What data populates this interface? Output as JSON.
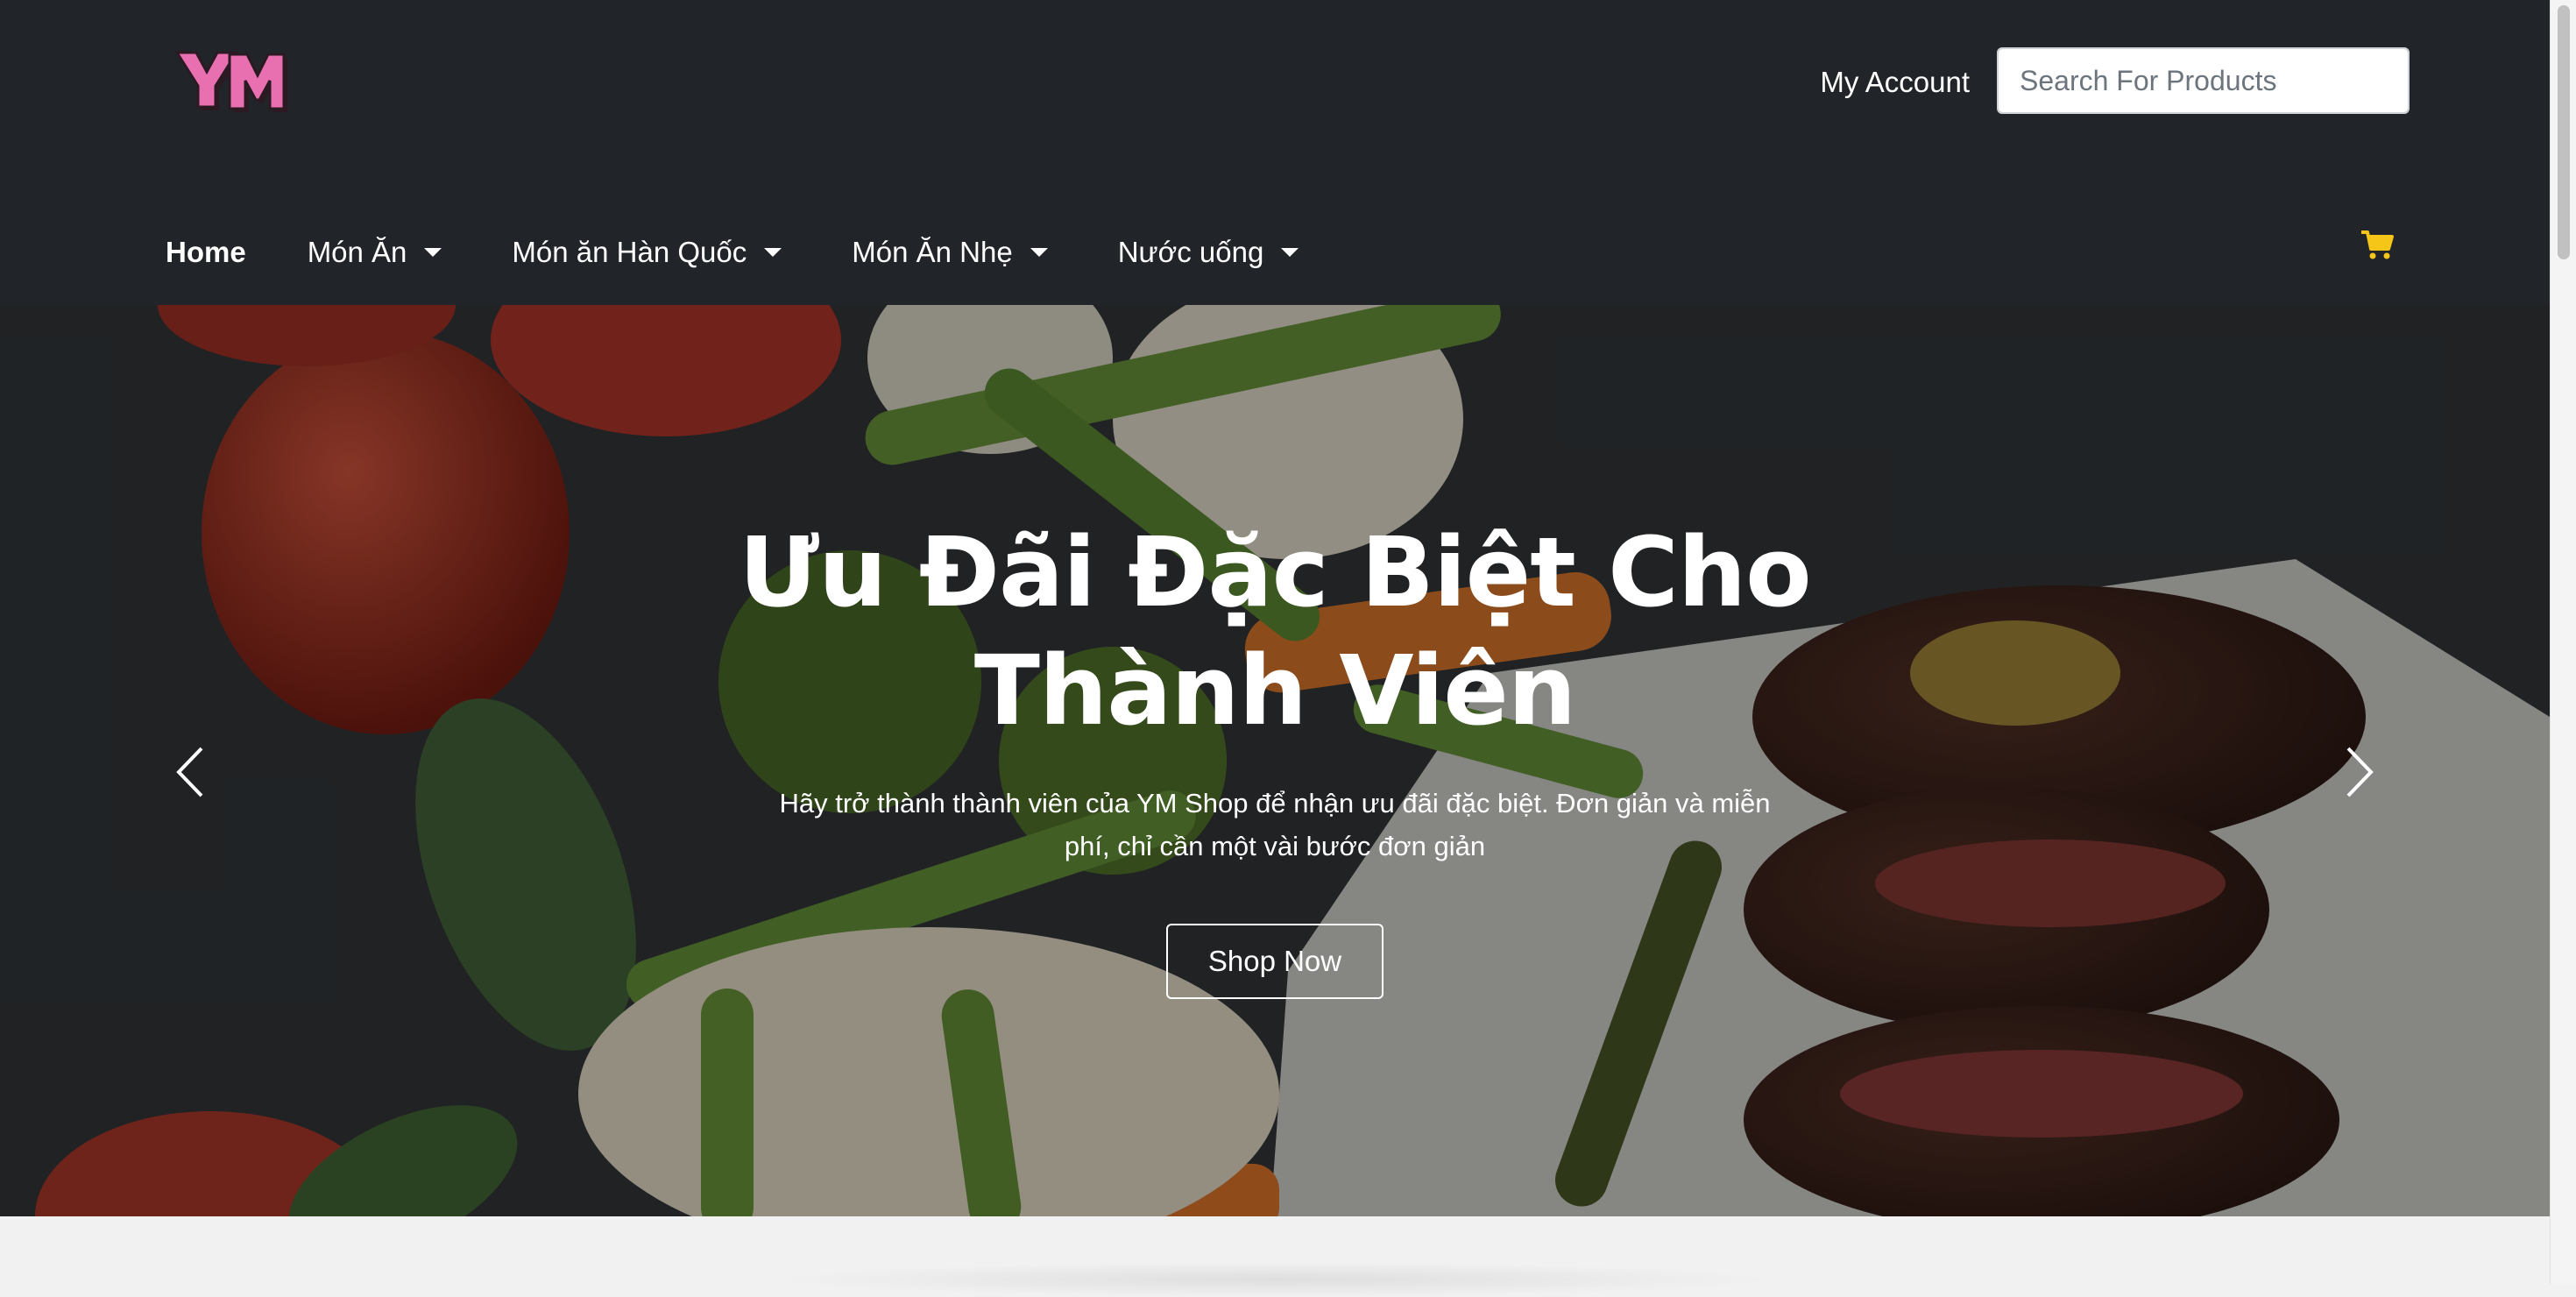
{
  "header": {
    "logo_text": "YM",
    "account_label": "My Account",
    "search": {
      "placeholder": "Search For Products"
    },
    "nav": [
      {
        "label": "Home",
        "dropdown": false
      },
      {
        "label": "Món Ăn",
        "dropdown": true
      },
      {
        "label": "Món ăn Hàn Quốc",
        "dropdown": true
      },
      {
        "label": "Món Ăn Nhẹ",
        "dropdown": true
      },
      {
        "label": "Nước uống",
        "dropdown": true
      }
    ],
    "icons": {
      "search": "search-icon",
      "cart": "cart-icon"
    }
  },
  "hero": {
    "title": "Ưu Đãi Đặc Biệt Cho Thành Viên",
    "description": "Hãy trở thành thành viên của YM Shop để nhận ưu đãi đặc biệt. Đơn giản và miễn phí, chỉ cần một vài bước đơn giản",
    "button_label": "Shop Now",
    "prev_icon": "chevron-left-icon",
    "next_icon": "chevron-right-icon"
  },
  "colors": {
    "header_bg": "#212529",
    "accent": "#f5c518",
    "logo_pink": "#e86fb0"
  }
}
